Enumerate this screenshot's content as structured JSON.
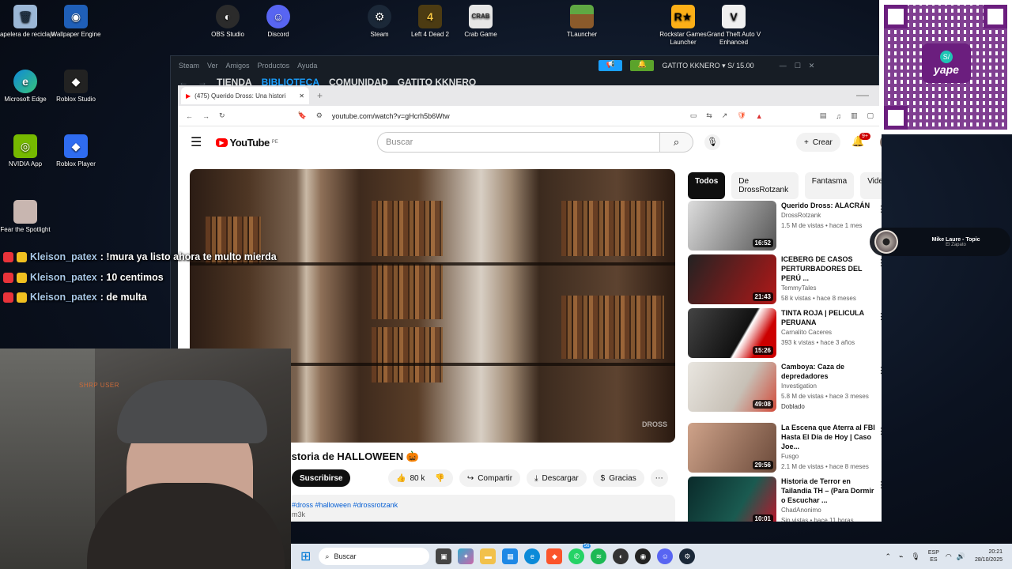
{
  "desktop": {
    "icons_left": [
      {
        "label": "Papelera de reciclaje",
        "icon": "recycle-bin-icon"
      },
      {
        "label": "Wallpaper Engine",
        "icon": "wallpaper-engine-icon"
      },
      {
        "label": "Microsoft Edge",
        "icon": "edge-icon"
      },
      {
        "label": "Roblox Studio",
        "icon": "roblox-studio-icon"
      },
      {
        "label": "NVIDIA App",
        "icon": "nvidia-icon"
      },
      {
        "label": "Roblox Player",
        "icon": "roblox-player-icon"
      },
      {
        "label": "Fear the Spotlight",
        "icon": "game-icon"
      }
    ],
    "icons_top": [
      {
        "label": "OBS Studio",
        "icon": "obs-icon"
      },
      {
        "label": "Discord",
        "icon": "discord-icon"
      },
      {
        "label": "Steam",
        "icon": "steam-icon"
      },
      {
        "label": "Left 4 Dead 2",
        "icon": "l4d2-icon"
      },
      {
        "label": "Crab Game",
        "icon": "crab-game-icon"
      },
      {
        "label": "TLauncher",
        "icon": "tlauncher-icon"
      },
      {
        "label": "Rockstar Games Launcher",
        "icon": "rockstar-icon"
      },
      {
        "label": "Grand Theft Auto V Enhanced",
        "icon": "gta-icon"
      }
    ]
  },
  "steam": {
    "menu": [
      "Steam",
      "Ver",
      "Amigos",
      "Productos",
      "Ayuda"
    ],
    "nav": [
      "TIENDA",
      "BIBLIOTECA",
      "COMUNIDAD",
      "GATITO KKNERO"
    ],
    "user_label": "GATITO KKNERO",
    "balance": "S/ 15.00"
  },
  "browser": {
    "tab_title": "(475) Querido Dross: Una histori",
    "url": "youtube.com/watch?v=gHcrh5b6Wtw"
  },
  "youtube": {
    "logo": "YouTube",
    "region": "PE",
    "search_placeholder": "Buscar",
    "create_label": "Crear",
    "notif_count": "9+",
    "chips": [
      "Todos",
      "De DrossRotzank",
      "Fantasma",
      "Video"
    ],
    "video_title": "istoria de HALLOWEEN 🎃",
    "subscribe": "Suscribirse",
    "likes": "80 k",
    "share": "Compartir",
    "download": "Descargar",
    "thanks": "Gracias",
    "desc_tags": "#dross #halloween #drossrotzank",
    "desc_views": "m3k",
    "watermark": "DROSS",
    "recommendations": [
      {
        "title": "Querido Dross: ALACRÁN",
        "channel": "DrossRotzank",
        "meta": "1.5 M de vistas • hace 1 mes",
        "duration": "16:52",
        "extra": ""
      },
      {
        "title": "ICEBERG DE CASOS PERTURBADORES DEL PERÚ ...",
        "channel": "TemmyTales",
        "meta": "58 k vistas • hace 8 meses",
        "duration": "21:43",
        "extra": ""
      },
      {
        "title": "TINTA ROJA | PELICULA PERUANA",
        "channel": "Carnalito Caceres",
        "meta": "393 k vistas • hace 3 años",
        "duration": "15:26",
        "extra": ""
      },
      {
        "title": "Camboya: Caza de depredadores",
        "channel": "Investigation",
        "meta": "5.8 M de vistas • hace 3 meses",
        "duration": "49:08",
        "extra": "Doblado"
      },
      {
        "title": "La Escena que Aterra al FBI Hasta El Día de Hoy | Caso Joe...",
        "channel": "Fusgo",
        "meta": "2.1 M de vistas • hace 8 meses",
        "duration": "29:56",
        "extra": ""
      },
      {
        "title": "Historia de Terror en Tailandia TH – (Para Dormir o Escuchar ...",
        "channel": "ChadAnonimo",
        "meta": "Sin vistas • hace 11 horas",
        "duration": "10:01",
        "extra": ""
      }
    ]
  },
  "chat": [
    {
      "user": "Kleison_patex",
      "message": ": !mura ya listo ahora te multo mierda"
    },
    {
      "user": "Kleison_patex",
      "message": ": 10 centimos"
    },
    {
      "user": "Kleison_patex",
      "message": ": de multa"
    }
  ],
  "now_playing": {
    "artist": "Mike Laure - Topic",
    "track": "El Zapato"
  },
  "qr": {
    "brand": "yape"
  },
  "webcam": {
    "overlay_text": "SHRP USER"
  },
  "taskbar": {
    "search_placeholder": "Buscar",
    "lang_top": "ESP",
    "lang_bottom": "ES",
    "time": "20:21",
    "date": "28/10/2025",
    "whatsapp_badge": "56"
  },
  "colors": {
    "accent_red": "#ff0000",
    "steam_blue": "#1a9fff",
    "yape_purple": "#6b1e7e"
  }
}
